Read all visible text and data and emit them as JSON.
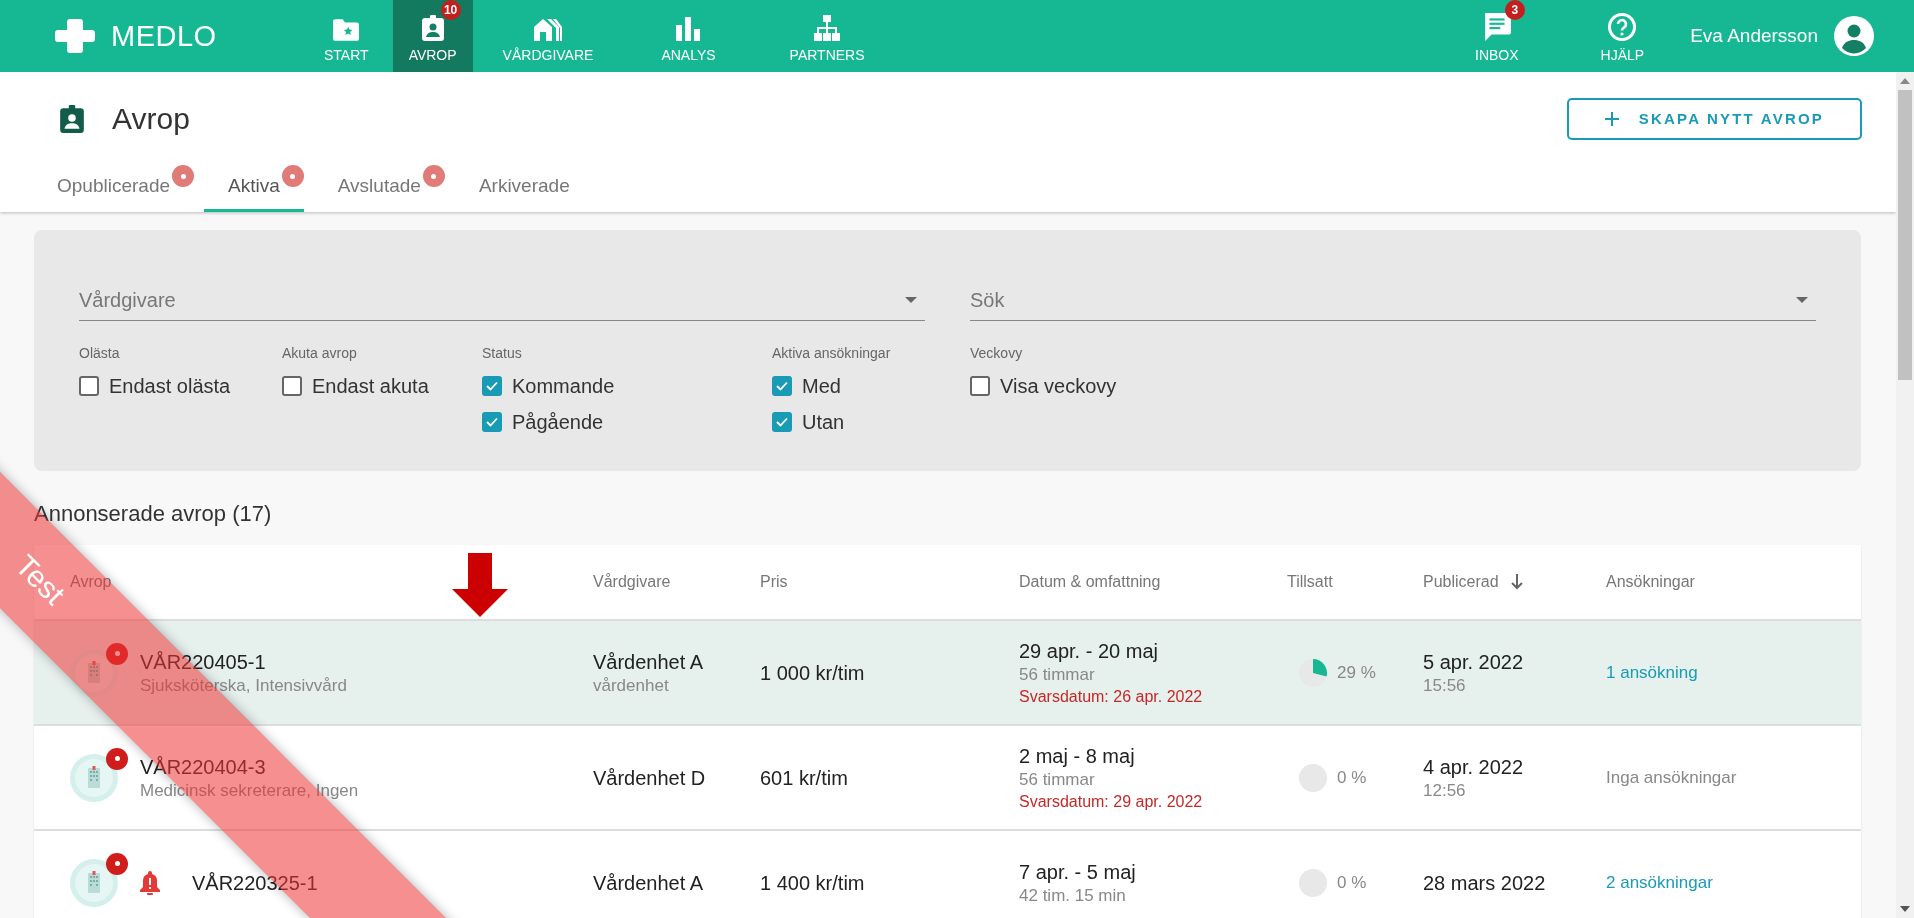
{
  "brand": "MEDLO",
  "nav": [
    {
      "label": "START",
      "selected": false
    },
    {
      "label": "AVROP",
      "selected": true,
      "count": "10"
    },
    {
      "label": "VÅRDGIVARE",
      "selected": false
    },
    {
      "label": "ANALYS",
      "selected": false
    },
    {
      "label": "PARTNERS",
      "selected": false
    }
  ],
  "actions": [
    {
      "label": "INBOX",
      "count": "3"
    },
    {
      "label": "HJÄLP"
    }
  ],
  "user": "Eva Andersson",
  "page_title": "Avrop",
  "create_button": "SKAPA NYTT AVROP",
  "tabs": [
    {
      "label": "Opublicerade",
      "selected": false,
      "unread": true
    },
    {
      "label": "Aktiva",
      "selected": true,
      "unread": true
    },
    {
      "label": "Avslutade",
      "selected": false,
      "unread": true
    },
    {
      "label": "Arkiverade",
      "selected": false,
      "unread": false
    }
  ],
  "filters": {
    "fields": [
      {
        "placeholder": "Vårdgivare"
      },
      {
        "placeholder": "Sök"
      }
    ],
    "groups": [
      {
        "title": "Olästa",
        "options": [
          {
            "label": "Endast olästa",
            "checked": false
          }
        ]
      },
      {
        "title": "Akuta avrop",
        "options": [
          {
            "label": "Endast akuta",
            "checked": false
          }
        ]
      },
      {
        "title": "Status",
        "options": [
          {
            "label": "Kommande",
            "checked": true
          },
          {
            "label": "Pågående",
            "checked": true
          }
        ]
      },
      {
        "title": "Aktiva ansökningar",
        "options": [
          {
            "label": "Med",
            "checked": true
          },
          {
            "label": "Utan",
            "checked": true
          }
        ]
      },
      {
        "title": "Veckovy",
        "options": [
          {
            "label": "Visa veckovy",
            "checked": false
          }
        ]
      }
    ]
  },
  "list_title": "Annonserade avrop (17)",
  "table": {
    "columns": [
      {
        "label": "Avrop",
        "sorted": false
      },
      {
        "label": "Vårdgivare",
        "sorted": false
      },
      {
        "label": "Pris",
        "sorted": false
      },
      {
        "label": "Datum & omfattning",
        "sorted": false
      },
      {
        "label": "Tillsatt",
        "sorted": false
      },
      {
        "label": "Publicerad",
        "sorted": true
      },
      {
        "label": "Ansökningar",
        "sorted": false
      }
    ],
    "rows": [
      {
        "id": "VÅR220405-1",
        "subtitle": "Sjuksköterska, Intensivvård",
        "selected": true,
        "unread": true,
        "urgent": false,
        "provider": "Vårdenhet A",
        "provider_sub": "vårdenhet",
        "price": "1 000 kr/tim",
        "dates": "29 apr. - 20 maj",
        "hours": "56 timmar",
        "deadline": "Svarsdatum: 26 apr. 2022",
        "filled": {
          "reading": "29 %"
        },
        "published": "5 apr. 2022",
        "published_time": "15:56",
        "applications": {
          "text": "1 ansökning",
          "kind": "link"
        }
      },
      {
        "id": "VÅR220404-3",
        "subtitle": "Medicinsk sekreterare, Ingen",
        "selected": false,
        "unread": true,
        "urgent": false,
        "provider": "Vårdenhet D",
        "price": "601 kr/tim",
        "dates": "2 maj - 8 maj",
        "hours": "56 timmar",
        "deadline": "Svarsdatum: 29 apr. 2022",
        "filled": {
          "reading": "0 %"
        },
        "published": "4 apr. 2022",
        "published_time": "12:56",
        "applications": {
          "text": "Inga ansökningar",
          "kind": "none"
        }
      },
      {
        "id": "VÅR220325-1",
        "selected": false,
        "unread": true,
        "urgent": true,
        "provider": "Vårdenhet A",
        "price": "1 400 kr/tim",
        "dates": "7 apr. - 5 maj",
        "hours": "42 tim. 15 min",
        "filled": {
          "reading": "0 %"
        },
        "published": "28 mars 2022",
        "applications": {
          "text": "2 ansökningar",
          "kind": "link"
        }
      }
    ]
  },
  "ribbon": "Test"
}
